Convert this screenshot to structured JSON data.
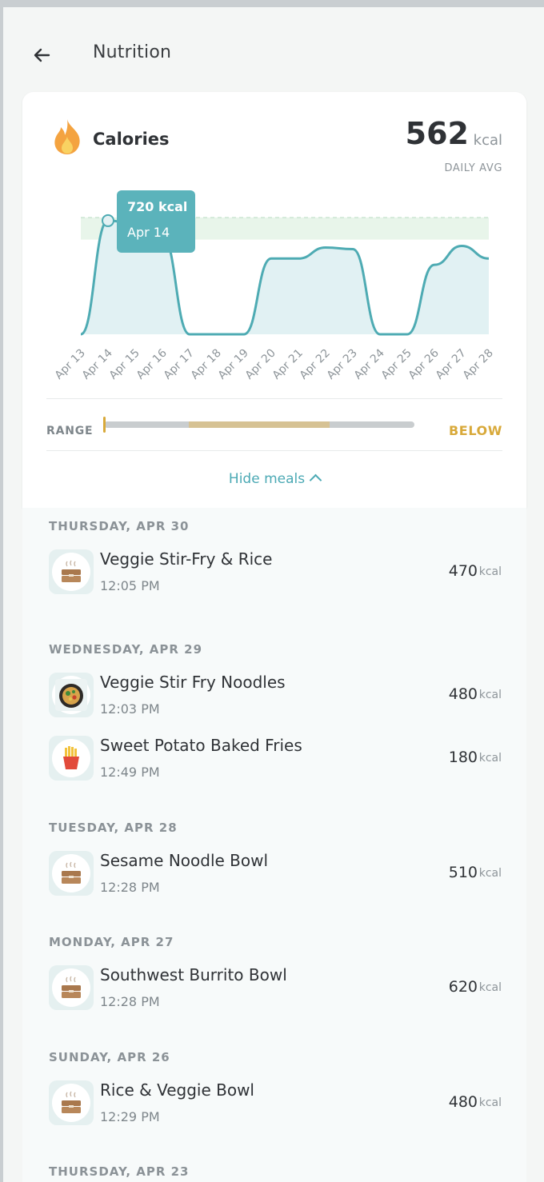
{
  "header": {
    "title": "Nutrition"
  },
  "summary": {
    "label": "Calories",
    "value": "562",
    "unit": "kcal",
    "subtitle": "DAILY AVG"
  },
  "chart_data": {
    "type": "area",
    "x": [
      "Apr 13",
      "Apr 14",
      "Apr 15",
      "Apr 16",
      "Apr 17",
      "Apr 18",
      "Apr 19",
      "Apr 20",
      "Apr 21",
      "Apr 22",
      "Apr 23",
      "Apr 24",
      "Apr 25",
      "Apr 26",
      "Apr 27",
      "Apr 28"
    ],
    "values": [
      0,
      720,
      700,
      620,
      0,
      0,
      0,
      480,
      480,
      550,
      540,
      0,
      0,
      440,
      560,
      480
    ],
    "ylim": [
      0,
      750
    ],
    "target_band": [
      600,
      740
    ],
    "tooltip": {
      "value": "720 kcal",
      "label": "Apr 14",
      "index": 1
    },
    "colors": {
      "line": "#4eabb3",
      "fill": "#e1f1f3",
      "band": "#e8f5ea",
      "tooltip": "#5bb3bb"
    }
  },
  "range": {
    "label": "RANGE",
    "status": "BELOW",
    "level": 0.0
  },
  "toggle": {
    "label": "Hide meals"
  },
  "groups": [
    {
      "day": "THURSDAY, APR 30",
      "meals": [
        {
          "name": "Veggie Stir-Fry & Rice",
          "time": "12:05 PM",
          "kcal": "470",
          "unit": "kcal",
          "icon": "takeout-box-icon"
        }
      ]
    },
    {
      "day": "WEDNESDAY, APR 29",
      "meals": [
        {
          "name": "Veggie Stir Fry Noodles",
          "time": "12:03 PM",
          "kcal": "480",
          "unit": "kcal",
          "icon": "noodle-pan-photo"
        },
        {
          "name": "Sweet Potato Baked Fries",
          "time": "12:49 PM",
          "kcal": "180",
          "unit": "kcal",
          "icon": "fries-icon"
        }
      ]
    },
    {
      "day": "TUESDAY, APR 28",
      "meals": [
        {
          "name": "Sesame Noodle Bowl",
          "time": "12:28 PM",
          "kcal": "510",
          "unit": "kcal",
          "icon": "takeout-box-icon"
        }
      ]
    },
    {
      "day": "MONDAY, APR 27",
      "meals": [
        {
          "name": "Southwest Burrito Bowl",
          "time": "12:28 PM",
          "kcal": "620",
          "unit": "kcal",
          "icon": "takeout-box-icon"
        }
      ]
    },
    {
      "day": "SUNDAY, APR 26",
      "meals": [
        {
          "name": "Rice & Veggie Bowl",
          "time": "12:29 PM",
          "kcal": "480",
          "unit": "kcal",
          "icon": "takeout-box-icon"
        }
      ]
    },
    {
      "day": "THURSDAY, APR 23",
      "meals": []
    }
  ]
}
